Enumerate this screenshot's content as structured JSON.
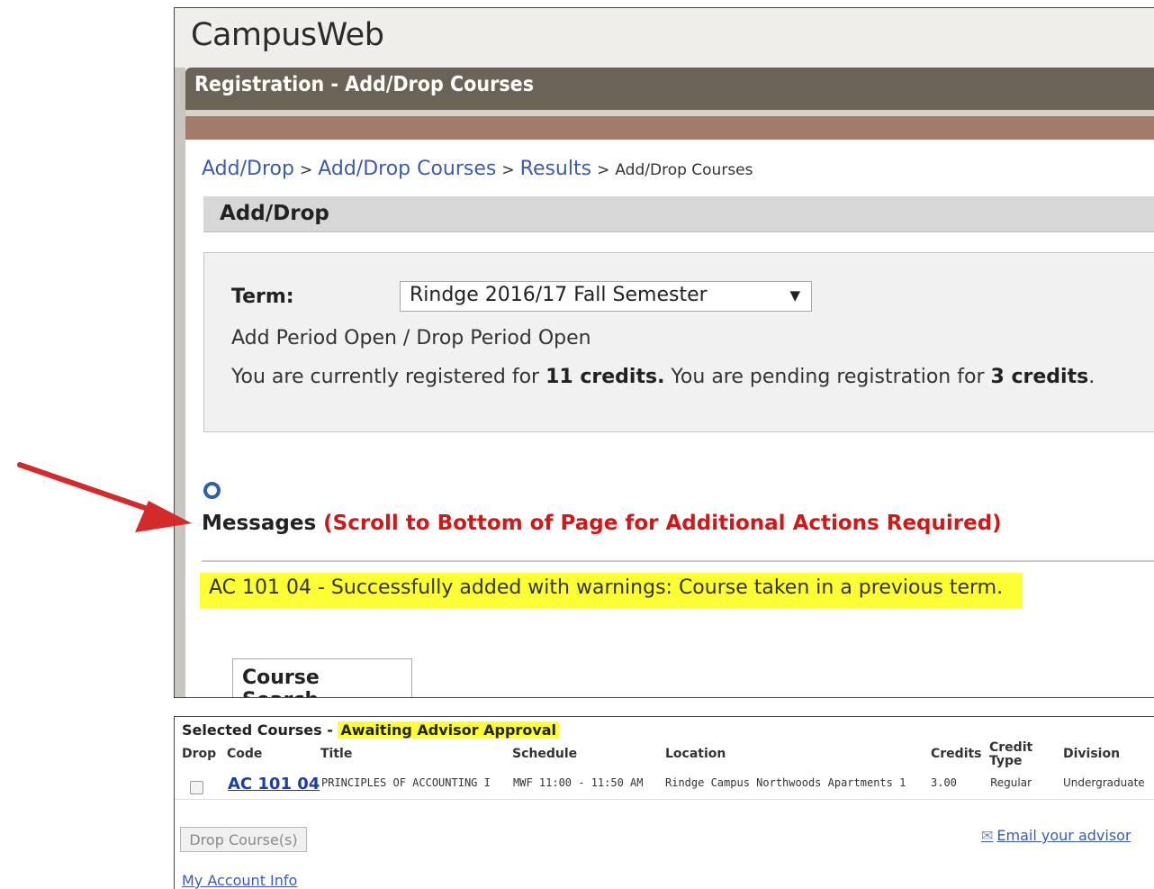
{
  "app": {
    "brand": "CampusWeb"
  },
  "page": {
    "title": "Registration - Add/Drop Courses"
  },
  "breadcrumb": {
    "links": [
      "Add/Drop",
      "Add/Drop Courses",
      "Results"
    ],
    "current": "Add/Drop Courses",
    "separator": ">"
  },
  "section": {
    "title": "Add/Drop"
  },
  "term": {
    "label": "Term:",
    "selected": "Rindge 2016/17 Fall Semester",
    "period": "Add Period Open / Drop Period Open",
    "credits_prefix": "You are currently registered for ",
    "registered_credits": "11 credits.",
    "credits_middle": " You are pending registration for ",
    "pending_credits": "3 credits",
    "credits_suffix": "."
  },
  "messages": {
    "title": "Messages",
    "note": "(Scroll to Bottom of Page for Additional Actions Required)",
    "items": [
      "AC 101 04 - Successfully added with warnings: Course taken in a previous term."
    ]
  },
  "tabs": {
    "course_search": "Course Search"
  },
  "selected_courses": {
    "title": "Selected Courses - ",
    "status": "Awaiting Advisor Approval",
    "columns": {
      "drop": "Drop",
      "code": "Code",
      "title": "Title",
      "schedule": "Schedule",
      "location": "Location",
      "credits": "Credits",
      "credit_type_1": "Credit",
      "credit_type_2": "Type",
      "division": "Division"
    },
    "rows": [
      {
        "code": "AC 101 04",
        "title": "PRINCIPLES OF ACCOUNTING I",
        "schedule": "MWF 11:00 - 11:50 AM",
        "location": "Rindge Campus Northwoods Apartments 1",
        "credits": "3.00",
        "credit_type": "Regular",
        "division": "Undergraduate"
      }
    ]
  },
  "actions": {
    "drop_button": "Drop Course(s)",
    "email_advisor": "Email your advisor",
    "account_info": "My Account Info"
  },
  "colors": {
    "title_bar": "#6b6356",
    "accent_bar": "#a17c6a",
    "link": "#3b5bb3",
    "highlight": "#fbff33",
    "alert_red": "#d01818",
    "annotation_arrow": "#d42a2a"
  },
  "icons": {
    "message": "circle-o-icon",
    "dropdown": "caret-down-icon",
    "email": "envelope-icon",
    "annotation": "red-arrow-icon"
  }
}
